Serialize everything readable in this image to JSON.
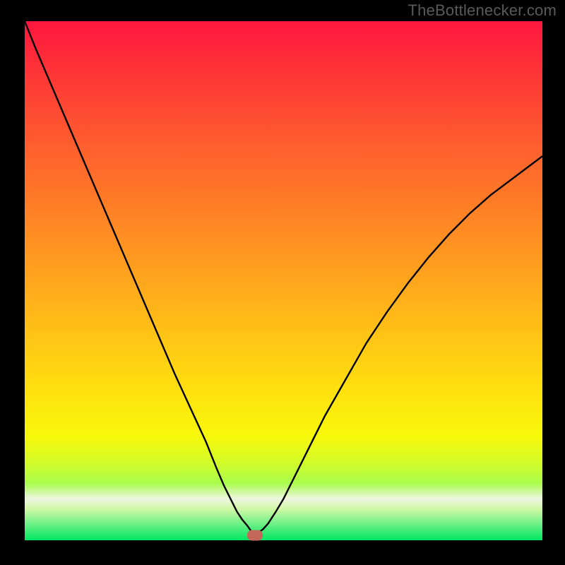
{
  "attribution": "TheBottlenecker.com",
  "chart_data": {
    "type": "line",
    "title": "",
    "xlabel": "",
    "ylabel": "",
    "xlim": [
      0,
      100
    ],
    "ylim": [
      0,
      100
    ],
    "x": [
      0,
      2,
      5,
      8,
      11,
      14,
      17,
      20,
      23,
      26,
      29,
      32,
      35,
      37,
      38.5,
      40,
      41,
      42,
      43,
      43.5,
      44,
      45,
      46,
      47,
      48.5,
      50,
      52,
      55,
      58,
      62,
      66,
      70,
      74,
      78,
      82,
      86,
      90,
      94,
      98,
      100
    ],
    "y": [
      100,
      95,
      88,
      81,
      74,
      67,
      60,
      53,
      46,
      39,
      32,
      25.5,
      19,
      14,
      10.5,
      7.5,
      5.5,
      4,
      2.8,
      2.1,
      1.4,
      1.4,
      2.1,
      3.2,
      5.5,
      8,
      12,
      18,
      24,
      31,
      38,
      44,
      49.5,
      54.5,
      59,
      63,
      66.5,
      69.5,
      72.5,
      74
    ],
    "marker": {
      "x": 44.5,
      "y": 1.0
    },
    "background_gradient": {
      "stops": [
        {
          "pos": 0.0,
          "color": "#fd163e"
        },
        {
          "pos": 0.5,
          "color": "#ffb11a"
        },
        {
          "pos": 0.78,
          "color": "#fff108"
        },
        {
          "pos": 1.0,
          "color": "#00e763"
        }
      ]
    }
  }
}
